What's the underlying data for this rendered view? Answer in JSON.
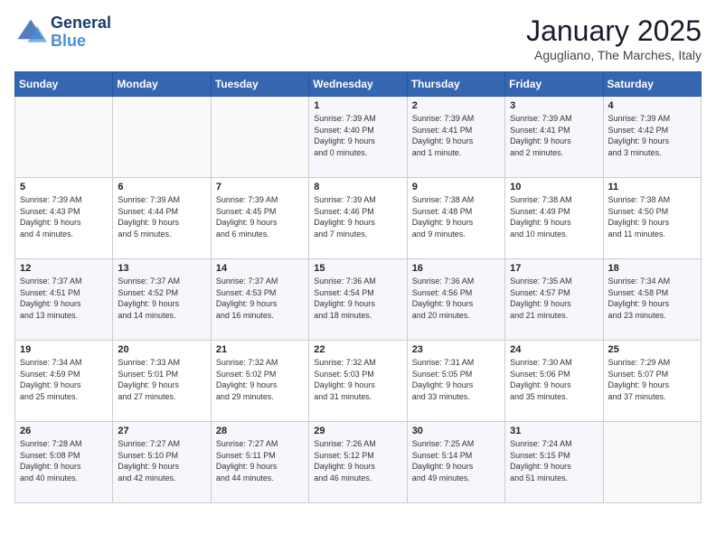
{
  "logo": {
    "line1": "General",
    "line2": "Blue"
  },
  "title": "January 2025",
  "subtitle": "Agugliano, The Marches, Italy",
  "days_of_week": [
    "Sunday",
    "Monday",
    "Tuesday",
    "Wednesday",
    "Thursday",
    "Friday",
    "Saturday"
  ],
  "weeks": [
    [
      {
        "day": "",
        "info": ""
      },
      {
        "day": "",
        "info": ""
      },
      {
        "day": "",
        "info": ""
      },
      {
        "day": "1",
        "info": "Sunrise: 7:39 AM\nSunset: 4:40 PM\nDaylight: 9 hours\nand 0 minutes."
      },
      {
        "day": "2",
        "info": "Sunrise: 7:39 AM\nSunset: 4:41 PM\nDaylight: 9 hours\nand 1 minute."
      },
      {
        "day": "3",
        "info": "Sunrise: 7:39 AM\nSunset: 4:41 PM\nDaylight: 9 hours\nand 2 minutes."
      },
      {
        "day": "4",
        "info": "Sunrise: 7:39 AM\nSunset: 4:42 PM\nDaylight: 9 hours\nand 3 minutes."
      }
    ],
    [
      {
        "day": "5",
        "info": "Sunrise: 7:39 AM\nSunset: 4:43 PM\nDaylight: 9 hours\nand 4 minutes."
      },
      {
        "day": "6",
        "info": "Sunrise: 7:39 AM\nSunset: 4:44 PM\nDaylight: 9 hours\nand 5 minutes."
      },
      {
        "day": "7",
        "info": "Sunrise: 7:39 AM\nSunset: 4:45 PM\nDaylight: 9 hours\nand 6 minutes."
      },
      {
        "day": "8",
        "info": "Sunrise: 7:39 AM\nSunset: 4:46 PM\nDaylight: 9 hours\nand 7 minutes."
      },
      {
        "day": "9",
        "info": "Sunrise: 7:38 AM\nSunset: 4:48 PM\nDaylight: 9 hours\nand 9 minutes."
      },
      {
        "day": "10",
        "info": "Sunrise: 7:38 AM\nSunset: 4:49 PM\nDaylight: 9 hours\nand 10 minutes."
      },
      {
        "day": "11",
        "info": "Sunrise: 7:38 AM\nSunset: 4:50 PM\nDaylight: 9 hours\nand 11 minutes."
      }
    ],
    [
      {
        "day": "12",
        "info": "Sunrise: 7:37 AM\nSunset: 4:51 PM\nDaylight: 9 hours\nand 13 minutes."
      },
      {
        "day": "13",
        "info": "Sunrise: 7:37 AM\nSunset: 4:52 PM\nDaylight: 9 hours\nand 14 minutes."
      },
      {
        "day": "14",
        "info": "Sunrise: 7:37 AM\nSunset: 4:53 PM\nDaylight: 9 hours\nand 16 minutes."
      },
      {
        "day": "15",
        "info": "Sunrise: 7:36 AM\nSunset: 4:54 PM\nDaylight: 9 hours\nand 18 minutes."
      },
      {
        "day": "16",
        "info": "Sunrise: 7:36 AM\nSunset: 4:56 PM\nDaylight: 9 hours\nand 20 minutes."
      },
      {
        "day": "17",
        "info": "Sunrise: 7:35 AM\nSunset: 4:57 PM\nDaylight: 9 hours\nand 21 minutes."
      },
      {
        "day": "18",
        "info": "Sunrise: 7:34 AM\nSunset: 4:58 PM\nDaylight: 9 hours\nand 23 minutes."
      }
    ],
    [
      {
        "day": "19",
        "info": "Sunrise: 7:34 AM\nSunset: 4:59 PM\nDaylight: 9 hours\nand 25 minutes."
      },
      {
        "day": "20",
        "info": "Sunrise: 7:33 AM\nSunset: 5:01 PM\nDaylight: 9 hours\nand 27 minutes."
      },
      {
        "day": "21",
        "info": "Sunrise: 7:32 AM\nSunset: 5:02 PM\nDaylight: 9 hours\nand 29 minutes."
      },
      {
        "day": "22",
        "info": "Sunrise: 7:32 AM\nSunset: 5:03 PM\nDaylight: 9 hours\nand 31 minutes."
      },
      {
        "day": "23",
        "info": "Sunrise: 7:31 AM\nSunset: 5:05 PM\nDaylight: 9 hours\nand 33 minutes."
      },
      {
        "day": "24",
        "info": "Sunrise: 7:30 AM\nSunset: 5:06 PM\nDaylight: 9 hours\nand 35 minutes."
      },
      {
        "day": "25",
        "info": "Sunrise: 7:29 AM\nSunset: 5:07 PM\nDaylight: 9 hours\nand 37 minutes."
      }
    ],
    [
      {
        "day": "26",
        "info": "Sunrise: 7:28 AM\nSunset: 5:08 PM\nDaylight: 9 hours\nand 40 minutes."
      },
      {
        "day": "27",
        "info": "Sunrise: 7:27 AM\nSunset: 5:10 PM\nDaylight: 9 hours\nand 42 minutes."
      },
      {
        "day": "28",
        "info": "Sunrise: 7:27 AM\nSunset: 5:11 PM\nDaylight: 9 hours\nand 44 minutes."
      },
      {
        "day": "29",
        "info": "Sunrise: 7:26 AM\nSunset: 5:12 PM\nDaylight: 9 hours\nand 46 minutes."
      },
      {
        "day": "30",
        "info": "Sunrise: 7:25 AM\nSunset: 5:14 PM\nDaylight: 9 hours\nand 49 minutes."
      },
      {
        "day": "31",
        "info": "Sunrise: 7:24 AM\nSunset: 5:15 PM\nDaylight: 9 hours\nand 51 minutes."
      },
      {
        "day": "",
        "info": ""
      }
    ]
  ]
}
